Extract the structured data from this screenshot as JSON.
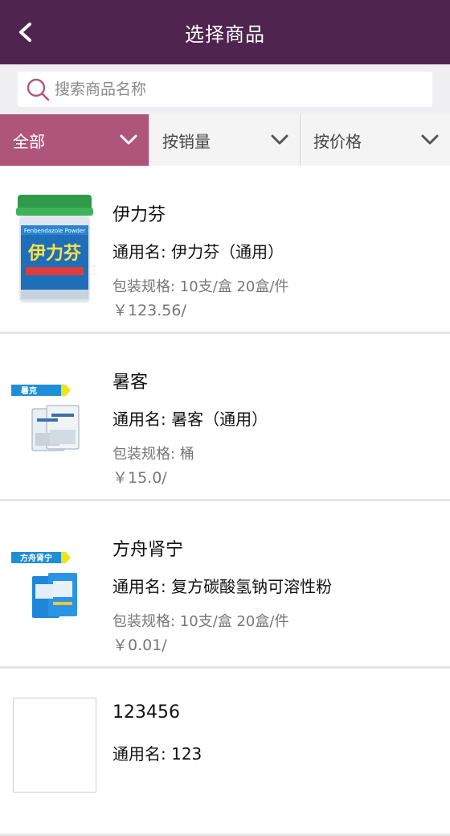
{
  "header": {
    "title": "选择商品",
    "back_icon": "chevron-left-icon",
    "bg_color": "#4f2550"
  },
  "search": {
    "placeholder": "搜索商品名称",
    "value": "",
    "icon": "search-icon"
  },
  "filters": [
    {
      "label": "全部",
      "active": true
    },
    {
      "label": "按销量",
      "active": false
    },
    {
      "label": "按价格",
      "active": false
    }
  ],
  "accent_color": "#b0557a",
  "products": [
    {
      "name": "伊力芬",
      "generic": "通用名: 伊力芬（通用）",
      "spec": "包装规格: 10支/盒 20盒/件",
      "price": "￥123.56/",
      "label_text": "伊力芬",
      "label_sub": "Fenbendazole Powder"
    },
    {
      "name": "暑客",
      "generic": "通用名: 暑客（通用）",
      "spec": "包装规格: 桶",
      "price": "￥15.0/",
      "label_text": "暑克"
    },
    {
      "name": "方舟肾宁",
      "generic": "通用名: 复方碳酸氢钠可溶性粉",
      "spec": "包装规格: 10支/盒 20盒/件",
      "price": "￥0.01/",
      "label_text": "方舟肾宁"
    },
    {
      "name": "123456",
      "generic": "通用名: 123",
      "spec": "",
      "price": ""
    }
  ]
}
